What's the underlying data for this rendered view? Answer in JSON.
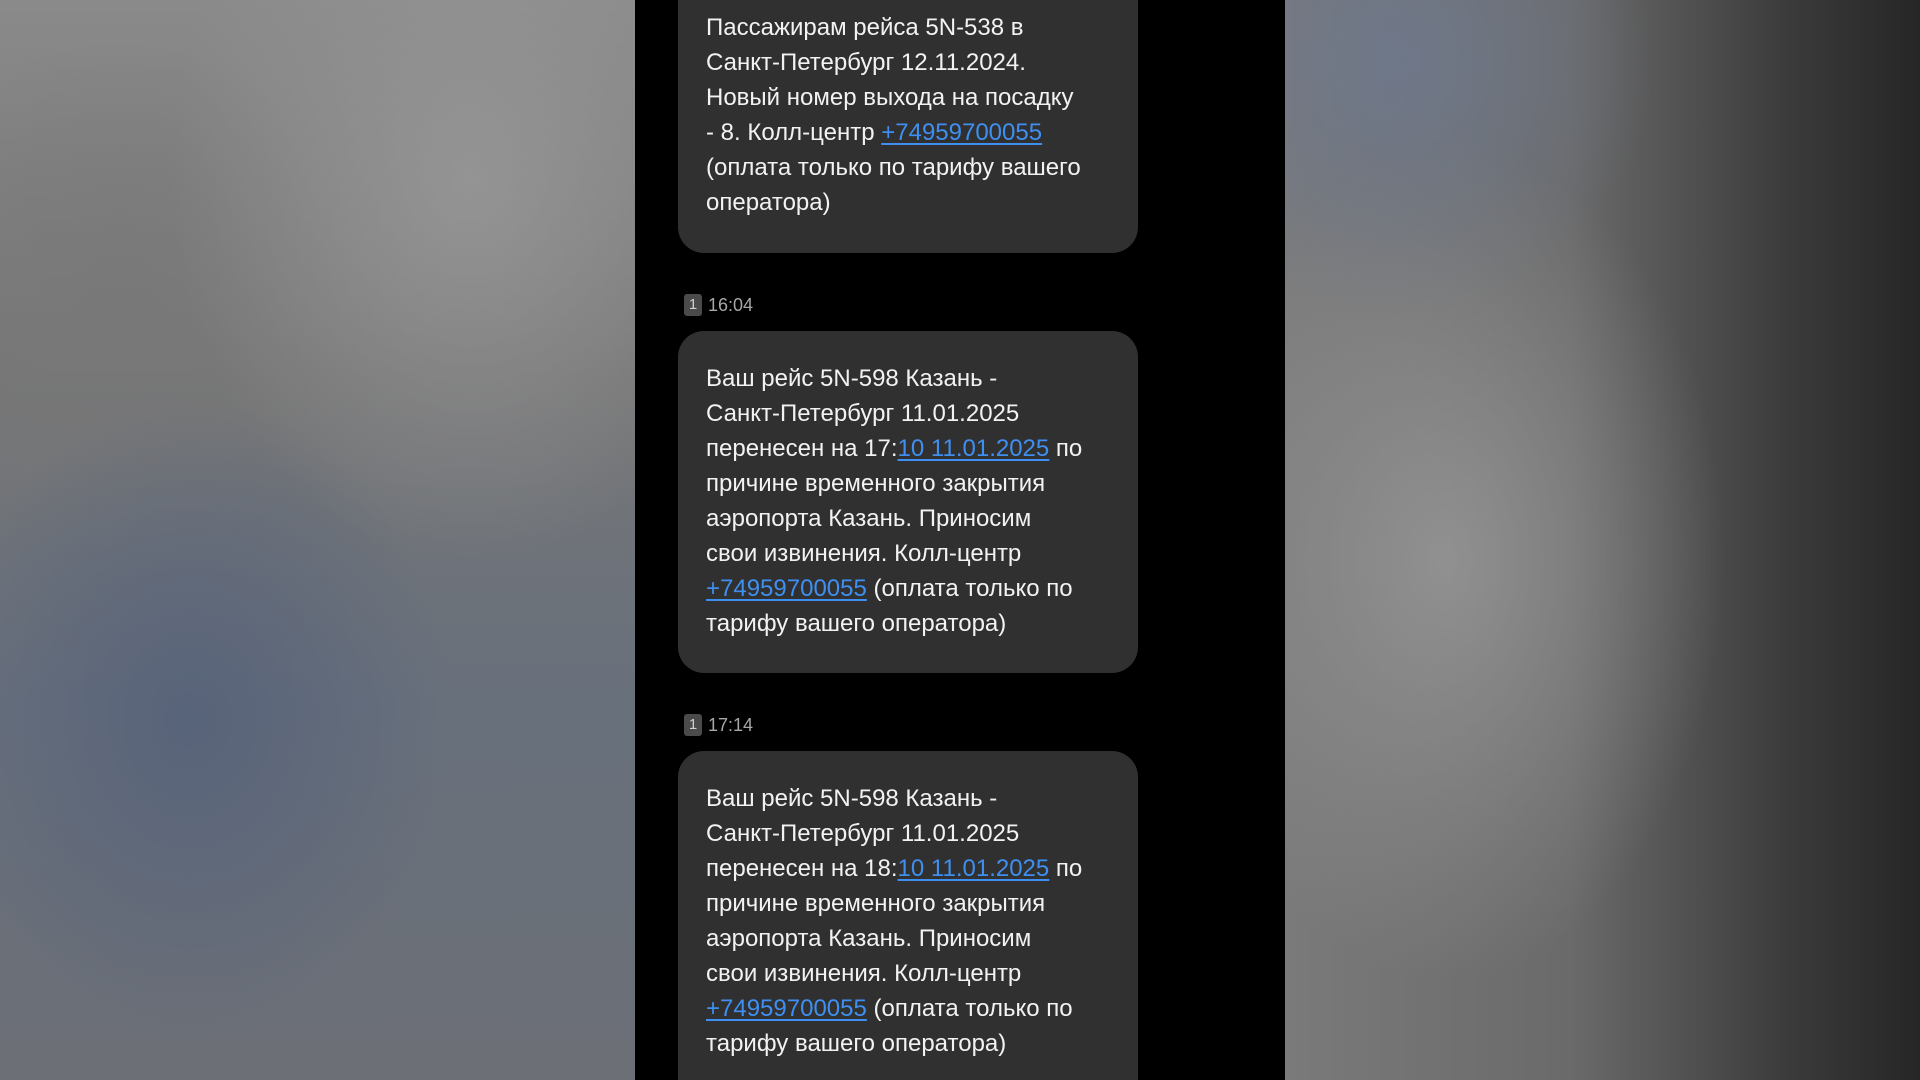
{
  "messages": [
    {
      "parts": [
        {
          "text": "Пассажирам рейса 5N-538 в",
          "link": false
        },
        {
          "text": "Санкт-Петербург 12.11.2024.",
          "link": false
        },
        {
          "text": "Новый номер выхода на посадку",
          "link": false
        },
        {
          "text": "- 8. Колл-центр ",
          "link": false
        },
        {
          "text": "+74959700055",
          "link": true
        },
        {
          "text": "(оплата только по тарифу вашего",
          "link": false
        },
        {
          "text": "оператора)",
          "link": false
        }
      ]
    },
    {
      "sim": "1",
      "time": "16:04",
      "parts": [
        {
          "text": "Ваш рейс 5N-598 Казань -",
          "link": false
        },
        {
          "text": "Санкт-Петербург 11.01.2025",
          "link": false
        },
        {
          "text": "перенесен на 17:",
          "link": false
        },
        {
          "text": "10 11.01.2025",
          "link": true
        },
        {
          "text": " по",
          "link": false
        },
        {
          "text": "причине временного закрытия",
          "link": false
        },
        {
          "text": "аэропорта Казань. Приносим",
          "link": false
        },
        {
          "text": "свои извинения. Колл-центр",
          "link": false
        },
        {
          "text": "+74959700055",
          "link": true
        },
        {
          "text": " (оплата только по",
          "link": false
        },
        {
          "text": "тарифу вашего оператора)",
          "link": false
        }
      ]
    },
    {
      "sim": "1",
      "time": "17:14",
      "parts": [
        {
          "text": "Ваш рейс 5N-598 Казань -",
          "link": false
        },
        {
          "text": "Санкт-Петербург 11.01.2025",
          "link": false
        },
        {
          "text": "перенесен на 18:",
          "link": false
        },
        {
          "text": "10 11.01.2025",
          "link": true
        },
        {
          "text": " по",
          "link": false
        },
        {
          "text": "причине временного закрытия",
          "link": false
        },
        {
          "text": "аэропорта Казань. Приносим",
          "link": false
        },
        {
          "text": "свои извинения. Колл-центр",
          "link": false
        },
        {
          "text": "+74959700055",
          "link": true
        },
        {
          "text": " (оплата только по",
          "link": false
        },
        {
          "text": "тарифу вашего оператора)",
          "link": false
        }
      ]
    }
  ],
  "colors": {
    "screen_bg": "#000000",
    "bubble_bg": "#303030",
    "text": "#f2f2f2",
    "link": "#3f8ff0",
    "meta": "#a7a7a7"
  }
}
